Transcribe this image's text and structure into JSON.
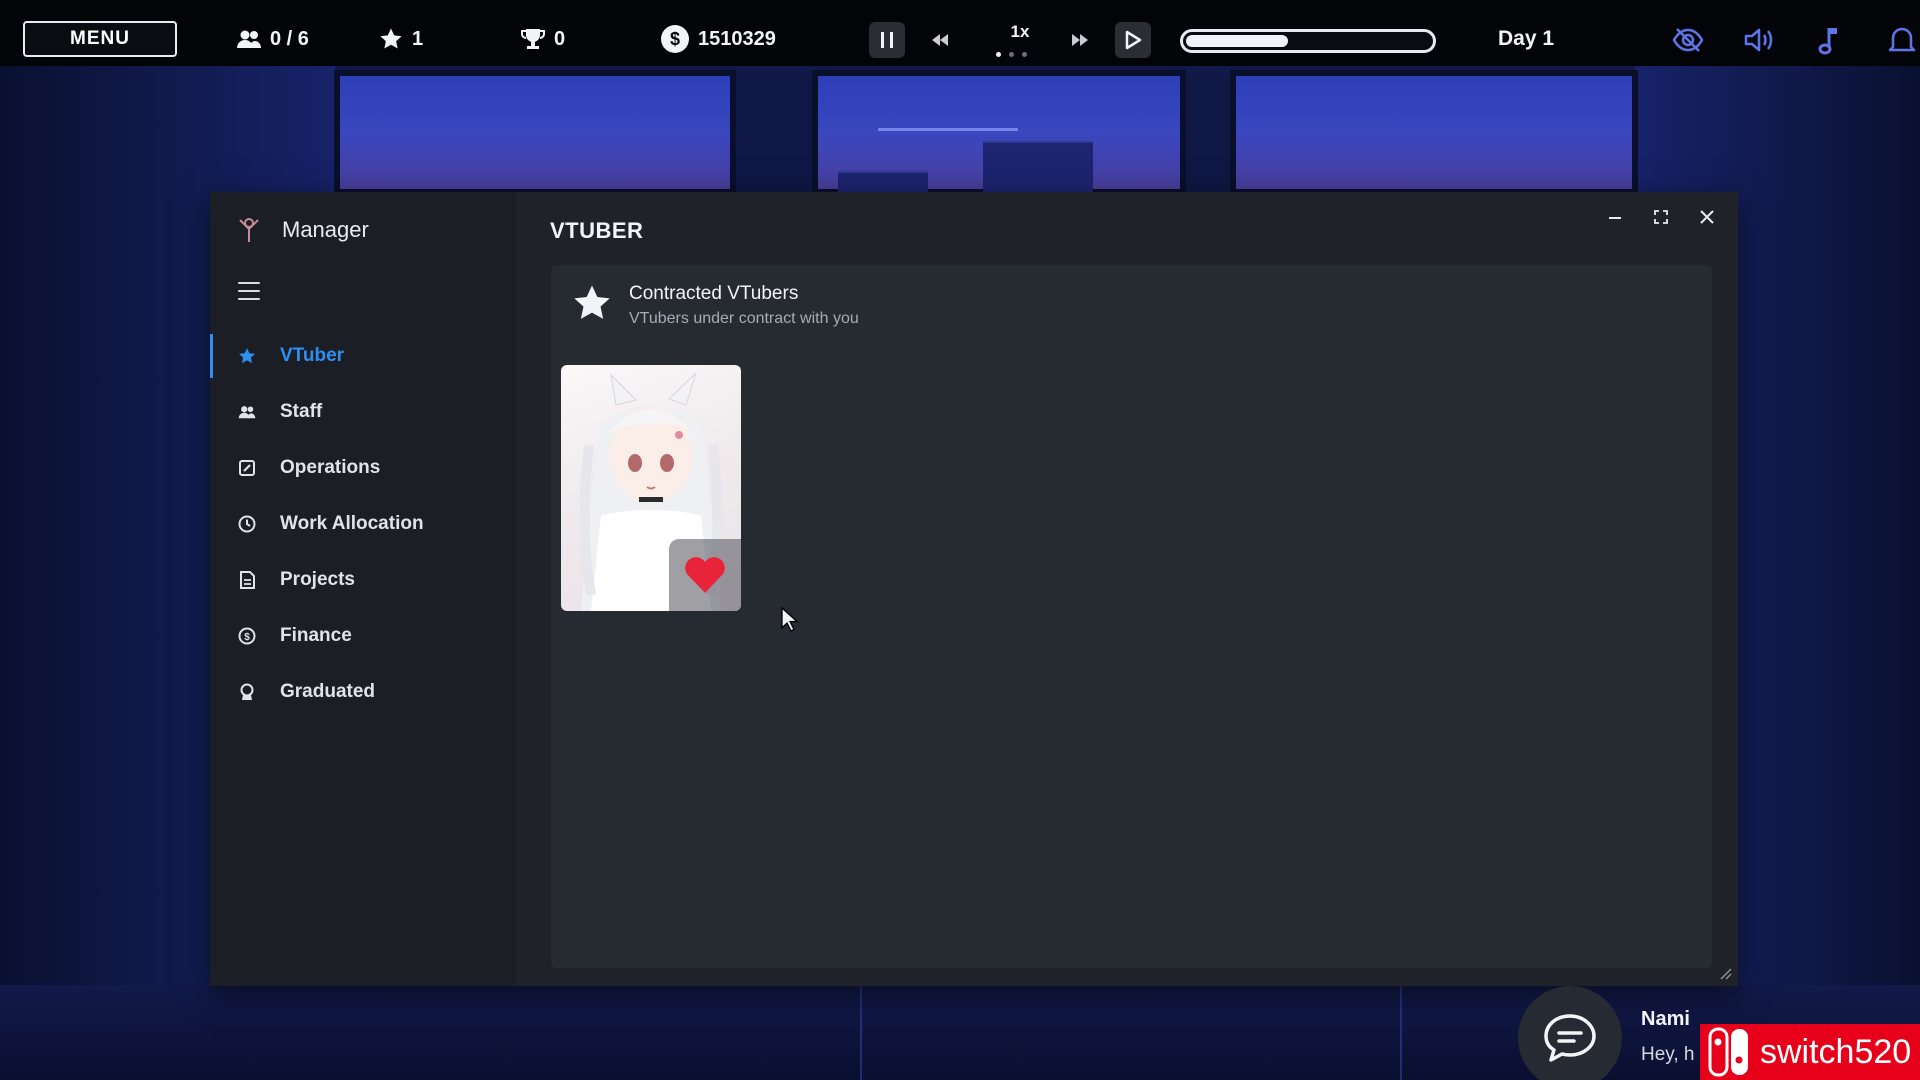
{
  "topbar": {
    "menu_label": "MENU",
    "staff_count": "0 / 6",
    "stars": "1",
    "trophies": "0",
    "money": "1510329",
    "speed": "1x",
    "day_progress": 0.42,
    "day_label": "Day 1"
  },
  "manager": {
    "title": "Manager",
    "nav": [
      {
        "label": "VTuber",
        "icon": "star-icon",
        "active": true
      },
      {
        "label": "Staff",
        "icon": "people-icon"
      },
      {
        "label": "Operations",
        "icon": "edit-square-icon"
      },
      {
        "label": "Work Allocation",
        "icon": "clock-icon"
      },
      {
        "label": "Projects",
        "icon": "document-icon"
      },
      {
        "label": "Finance",
        "icon": "coin-icon"
      },
      {
        "label": "Graduated",
        "icon": "badge-icon"
      }
    ],
    "section_title": "VTUBER",
    "panel": {
      "title": "Contracted VTubers",
      "subtitle": "VTubers under contract with you"
    }
  },
  "chat": {
    "name": "Nami",
    "text": "Hey, h"
  },
  "watermark": "switch520",
  "colors": {
    "accent": "#2f8ff0",
    "window_bg": "#1f2329",
    "sidebar_bg": "#1b1e24",
    "panel_bg": "#262a31",
    "topbar_bg": "#030407",
    "heart": "#e8243a"
  }
}
